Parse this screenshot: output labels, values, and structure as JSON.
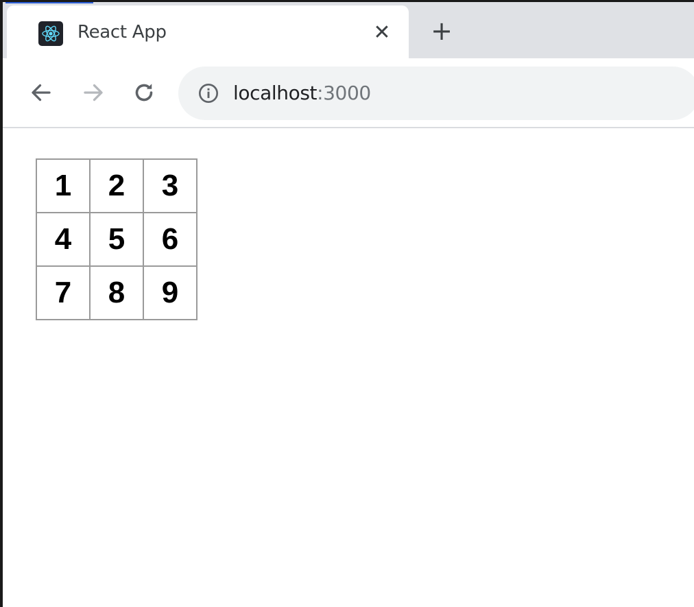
{
  "browser": {
    "tab": {
      "title": "React App",
      "favicon_icon": "react-logo-icon",
      "close_glyph": "✕"
    },
    "new_tab_glyph": "+",
    "nav": {
      "back_icon": "arrow-left-icon",
      "forward_icon": "arrow-right-icon",
      "reload_icon": "reload-icon"
    },
    "address": {
      "info_icon": "info-icon",
      "host": "localhost",
      "port": ":3000"
    },
    "colors": {
      "tabstrip": "#dfe1e5",
      "omnibox": "#f1f3f4",
      "react_blue": "#61dafb"
    }
  },
  "page": {
    "grid": {
      "rows": [
        [
          "1",
          "2",
          "3"
        ],
        [
          "4",
          "5",
          "6"
        ],
        [
          "7",
          "8",
          "9"
        ]
      ]
    }
  }
}
